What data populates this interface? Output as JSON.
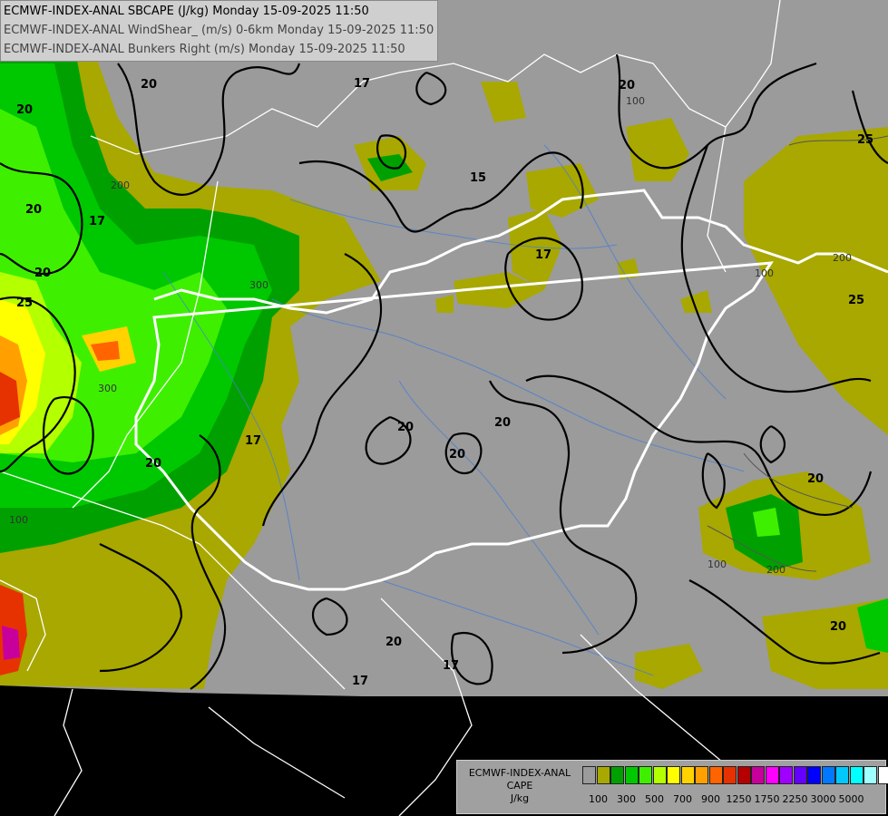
{
  "header": {
    "line1": "ECMWF-INDEX-ANAL SBCAPE (J/kg) Monday 15-09-2025 11:50",
    "line2": "ECMWF-INDEX-ANAL WindShear_ (m/s) 0-6km Monday 15-09-2025 11:50",
    "line3": "ECMWF-INDEX-ANAL Bunkers Right (m/s) Monday 15-09-2025 11:50"
  },
  "legend": {
    "title_line1": "ECMWF-INDEX-ANAL",
    "title_line2": "CAPE",
    "title_line3": "J/kg",
    "colors": [
      "#9b9b9b",
      "#a8a800",
      "#00a000",
      "#00c800",
      "#3ef000",
      "#b4ff00",
      "#ffff00",
      "#ffd200",
      "#ffa000",
      "#ff6400",
      "#e63200",
      "#b40000",
      "#c8009b",
      "#ff00ff",
      "#a000ff",
      "#6400ff",
      "#0000ff",
      "#0078ff",
      "#00c8ff",
      "#00ffff",
      "#a0ffff",
      "#ffffff"
    ],
    "labels": [
      "100",
      "300",
      "500",
      "700",
      "900",
      "1250",
      "1750",
      "2250",
      "3000",
      "5000"
    ]
  },
  "contour_labels": {
    "shear": [
      "20",
      "20",
      "17",
      "20",
      "25",
      "20",
      "17",
      "15",
      "17",
      "20",
      "20",
      "20",
      "20",
      "25",
      "25",
      "20",
      "20",
      "17",
      "17",
      "20",
      "20",
      "17"
    ],
    "cape": [
      "100",
      "200",
      "300",
      "300",
      "100",
      "200",
      "100",
      "200",
      "100"
    ]
  }
}
